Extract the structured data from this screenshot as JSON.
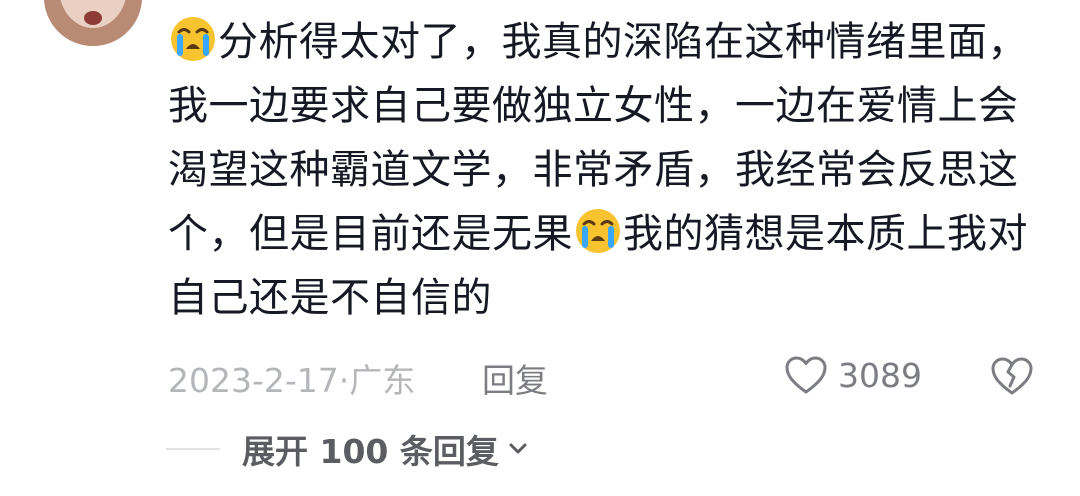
{
  "comment": {
    "avatar_icon": "user-avatar",
    "lines": [
      {
        "emoji_before": "loudly-crying-face",
        "text": "分析得太对了，我真的深陷在这种情绪里面，",
        "text_after": ""
      },
      {
        "text": "我一边要求自己要做独立女性，一边在爱情上会"
      },
      {
        "text": "渴望这种霸道文学，非常矛盾，我经常会反思这"
      },
      {
        "text": "个，但是目前还是无果",
        "emoji_after": "loudly-crying-face",
        "text_after": "我的猜想是本质上我对"
      },
      {
        "text": "自己还是不自信的"
      }
    ],
    "date": "2023-2-17·广东",
    "reply_label": "回复",
    "like_count": "3089",
    "like_icon": "heart-outline-icon",
    "dislike_icon": "broken-heart-icon"
  },
  "replies": {
    "expand_label": "展开 100 条回复",
    "expand_icon": "chevron-down-icon"
  },
  "colors": {
    "text_primary": "#161823",
    "text_secondary": "#7c7d82",
    "text_tertiary": "#b5b6b9",
    "emoji_face": "#f7c32e",
    "emoji_tears": "#3aa7ff"
  }
}
